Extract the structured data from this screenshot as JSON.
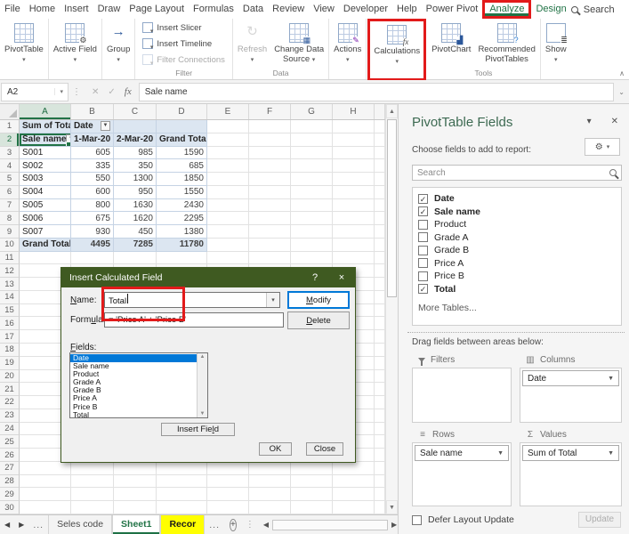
{
  "tabs": {
    "items": [
      {
        "label": "File"
      },
      {
        "label": "Home"
      },
      {
        "label": "Insert"
      },
      {
        "label": "Draw"
      },
      {
        "label": "Page Layout"
      },
      {
        "label": "Formulas"
      },
      {
        "label": "Data"
      },
      {
        "label": "Review"
      },
      {
        "label": "View"
      },
      {
        "label": "Developer"
      },
      {
        "label": "Help"
      },
      {
        "label": "Power Pivot"
      },
      {
        "label": "Analyze",
        "accent": true,
        "selected": true,
        "annotated": true
      },
      {
        "label": "Design",
        "accent": true
      }
    ],
    "search_label": "Search"
  },
  "ribbon": {
    "buttons": {
      "pivottable": "PivotTable",
      "active_field": "Active Field",
      "group": "Group",
      "insert_slicer": "Insert Slicer",
      "insert_timeline": "Insert Timeline",
      "filter_connections": "Filter Connections",
      "refresh": "Refresh",
      "change_data_line1": "Change Data",
      "change_data_line2": "Source",
      "actions": "Actions",
      "calculations": "Calculations",
      "pivotchart": "PivotChart",
      "recommended_line1": "Recommended",
      "recommended_line2": "PivotTables",
      "show": "Show"
    },
    "group_labels": {
      "filter": "Filter",
      "data": "Data",
      "tools": "Tools"
    }
  },
  "formula_bar": {
    "name_box": "A2",
    "formula": "Sale name"
  },
  "grid": {
    "columns": [
      "A",
      "B",
      "C",
      "D",
      "E",
      "F",
      "G",
      "H"
    ],
    "row_count": 30,
    "selected_column": "A",
    "selected_row": 2,
    "pivot": {
      "corner_label": "Sum of Total",
      "col_field_label": "Date",
      "row_field_label": "Sale name",
      "col_headers": [
        "1-Mar-20",
        "2-Mar-20",
        "Grand Total"
      ],
      "rows": [
        {
          "label": "S001",
          "values": [
            605,
            985,
            1590
          ]
        },
        {
          "label": "S002",
          "values": [
            335,
            350,
            685
          ]
        },
        {
          "label": "S003",
          "values": [
            550,
            1300,
            1850
          ]
        },
        {
          "label": "S004",
          "values": [
            600,
            950,
            1550
          ]
        },
        {
          "label": "S005",
          "values": [
            800,
            1630,
            2430
          ]
        },
        {
          "label": "S006",
          "values": [
            675,
            1620,
            2295
          ]
        },
        {
          "label": "S007",
          "values": [
            930,
            450,
            1380
          ]
        }
      ],
      "grand_total": {
        "label": "Grand Total",
        "values": [
          4495,
          7285,
          11780
        ]
      }
    }
  },
  "dialog": {
    "title": "Insert Calculated Field",
    "help": "?",
    "close": "×",
    "name_label": {
      "pre": "",
      "u": "N",
      "post": "ame:"
    },
    "name_value": "Total",
    "formula_label": {
      "pre": "Form",
      "u": "u",
      "post": "la:"
    },
    "formula_value": "= 'Price A' + 'Price B'",
    "fields_label": {
      "pre": "",
      "u": "F",
      "post": "ields:"
    },
    "fields": [
      "Date",
      "Sale name",
      "Product",
      "Grade A",
      "Grade B",
      "Price A",
      "Price B",
      "Total"
    ],
    "selected_field": "Date",
    "modify_label": {
      "pre": "",
      "u": "M",
      "post": "odify"
    },
    "delete_label": {
      "pre": "",
      "u": "D",
      "post": "elete"
    },
    "insert_field_label": {
      "pre": "Insert Fie",
      "u": "l",
      "post": "d"
    },
    "ok_label": "OK",
    "close_label": "Close"
  },
  "pane": {
    "title": "PivotTable Fields",
    "subtitle": "Choose fields to add to report:",
    "search_placeholder": "Search",
    "fields": [
      {
        "label": "Date",
        "checked": true
      },
      {
        "label": "Sale name",
        "checked": true
      },
      {
        "label": "Product",
        "checked": false
      },
      {
        "label": "Grade A",
        "checked": false
      },
      {
        "label": "Grade B",
        "checked": false
      },
      {
        "label": "Price A",
        "checked": false
      },
      {
        "label": "Price B",
        "checked": false
      },
      {
        "label": "Total",
        "checked": true
      }
    ],
    "more_tables": "More Tables...",
    "drag_hint": "Drag fields between areas below:",
    "areas": {
      "filters": {
        "label": "Filters",
        "items": []
      },
      "columns": {
        "label": "Columns",
        "items": [
          "Date"
        ]
      },
      "rows": {
        "label": "Rows",
        "items": [
          "Sale name"
        ]
      },
      "values": {
        "label": "Values",
        "items": [
          "Sum of Total"
        ]
      }
    },
    "defer_label": "Defer Layout Update",
    "update_label": "Update"
  },
  "sheet_bar": {
    "tabs": [
      {
        "label": "Seles code",
        "state": "normal"
      },
      {
        "label": "Sheet1",
        "state": "active"
      },
      {
        "label": "Recor",
        "state": "highlighted"
      }
    ],
    "overflow_left": "...",
    "overflow_right": "..."
  },
  "colors": {
    "excel_green": "#217346",
    "annotation_red": "#E21A1A",
    "dialog_title_bg": "#3F5A21",
    "pivot_fill": "#DCE6F1",
    "selection_blue": "#0078D7",
    "tab_highlight_yellow": "#FFFF00"
  }
}
